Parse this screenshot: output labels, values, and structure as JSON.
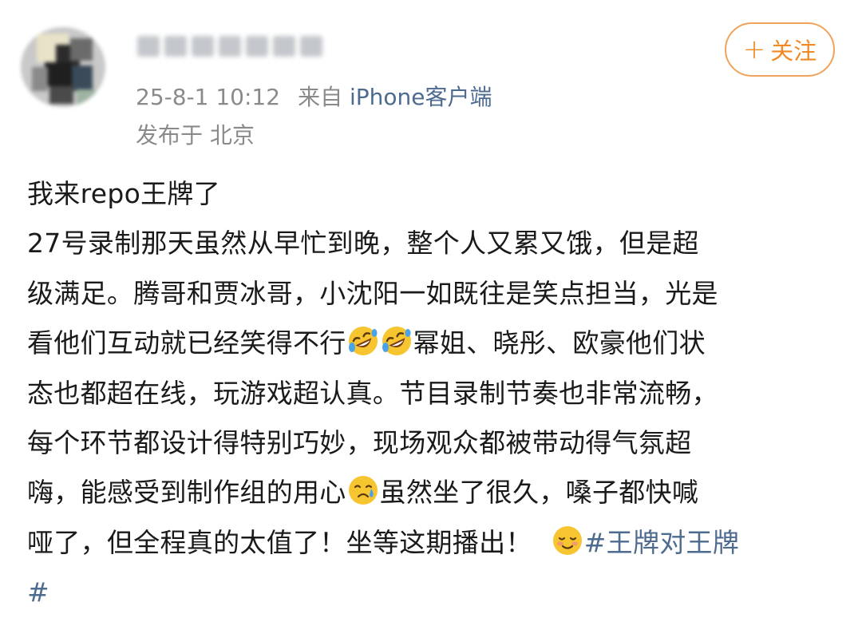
{
  "header": {
    "username_obscured": true,
    "timestamp": "25-8-1 10:12",
    "source_prefix": "来自",
    "source_client": "iPhone客户端",
    "location": "发布于 北京",
    "follow_button": {
      "plus": "+",
      "label": "关注"
    }
  },
  "post": {
    "line1": "我来repo王牌了",
    "line2": "27号录制那天虽然从早忙到晚，整个人又累又饿，但是超",
    "line3": "级满足。腾哥和贾冰哥，小沈阳一如既往是笑点担当，光是",
    "line4a": "看他们互动就已经笑得不行",
    "line4b": "幂姐、晓彤、欧豪他们状",
    "line5": "态也都超在线，玩游戏超认真。节目录制节奏也非常流畅，",
    "line6": "每个环节都设计得特别巧妙，现场观众都被带动得气氛超",
    "line7a": "嗨，能感受到制作组的用心",
    "line7b": "虽然坐了很久，嗓子都快喊",
    "line8a": "哑了，但全程真的太值了！坐等这期播出！",
    "hashtag_part1": "#王牌对王牌",
    "hashtag_part2": "#"
  },
  "emojis": [
    "rofl-emoji",
    "rofl-emoji",
    "tearful-smile-emoji",
    "smiling-blush-emoji"
  ],
  "colors": {
    "accent_orange": "#f08a24",
    "link_blue": "#4d6b8f",
    "meta_gray": "#8a8a8a"
  }
}
